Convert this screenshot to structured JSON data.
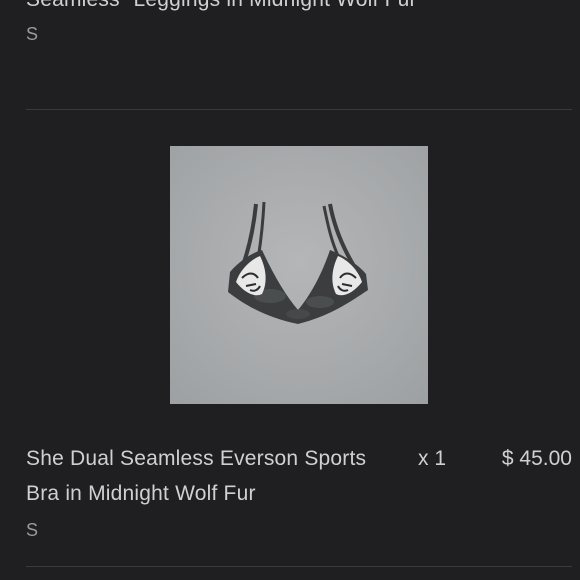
{
  "previous_item": {
    "title": "Seamless \"Leggings in Midnight Wolf Fur",
    "size": "S"
  },
  "current_item": {
    "title": "She Dual Seamless Everson Sports Bra in Midnight Wolf Fur",
    "size": "S",
    "quantity": "x 1",
    "price": "$ 45.00",
    "image": {
      "icon": "sports-bra-product-photo",
      "background_color": "#a9abad",
      "garment_color": "#3b3d3e"
    }
  }
}
